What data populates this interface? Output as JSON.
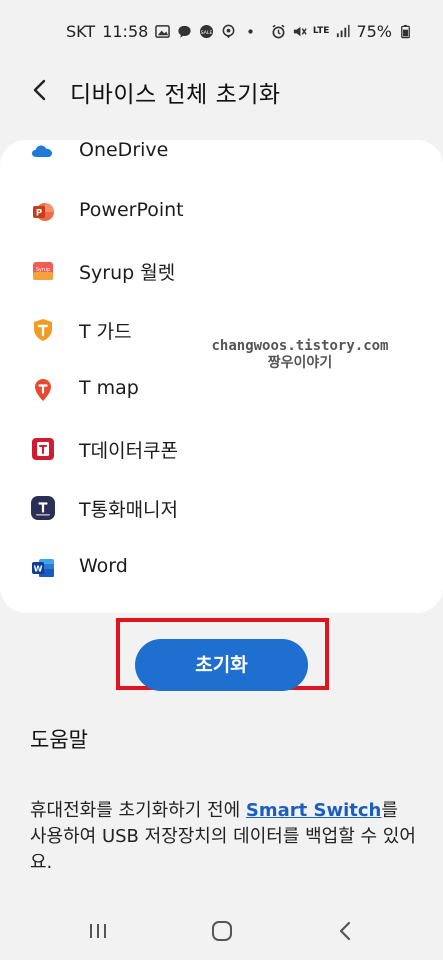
{
  "status_bar": {
    "carrier": "SKT",
    "time": "11:58",
    "battery": "75%",
    "network": "LTE"
  },
  "header": {
    "title": "디바이스 전체 초기화"
  },
  "apps": [
    {
      "label": "OneDrive",
      "icon": "onedrive-icon",
      "color": "#1f7ad8"
    },
    {
      "label": "PowerPoint",
      "icon": "powerpoint-icon",
      "color": "#d04423"
    },
    {
      "label": "Syrup 월렛",
      "icon": "syrup-wallet-icon",
      "color": "#ef5a52"
    },
    {
      "label": "T 가드",
      "icon": "t-guard-icon",
      "color": "#f0a22a"
    },
    {
      "label": "T map",
      "icon": "t-map-icon",
      "color": "#e0462d"
    },
    {
      "label": "T데이터쿠폰",
      "icon": "t-data-coupon-icon",
      "color": "#d11b33"
    },
    {
      "label": "T통화매니저",
      "icon": "t-call-manager-icon",
      "color": "#2b2f55"
    },
    {
      "label": "Word",
      "icon": "word-icon",
      "color": "#2b5aa8"
    }
  ],
  "reset_button": {
    "label": "초기화",
    "color": "#1f6fd0"
  },
  "help": {
    "title": "도움말",
    "text_before": "휴대전화를 초기화하기 전에 ",
    "link": "Smart Switch",
    "text_after": "를 사용하여 USB 저장장치의 데이터를 백업할 수 있어요."
  },
  "watermark": {
    "line1": "changwoos.tistory.com",
    "line2": "짱우이야기"
  }
}
